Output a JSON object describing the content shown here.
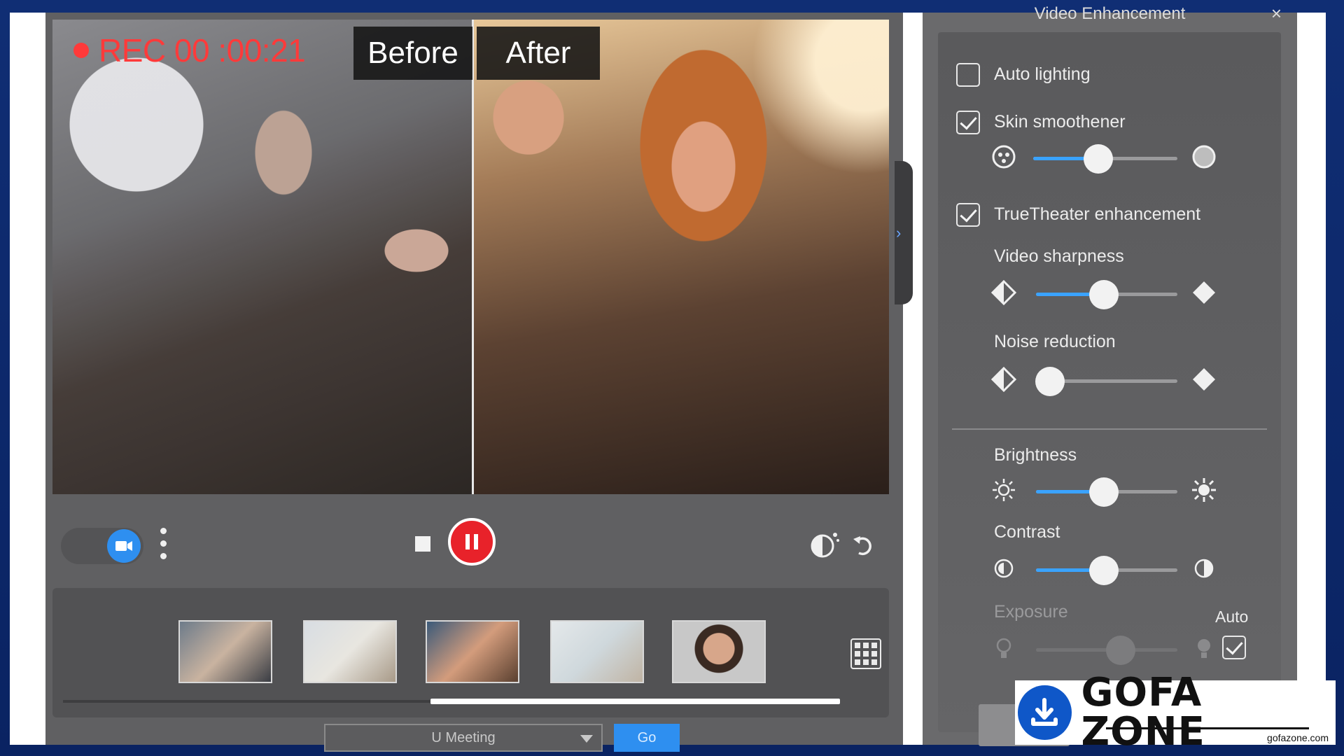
{
  "video": {
    "rec_text": "REC 00 :00:21",
    "before_label": "Before",
    "after_label": "After"
  },
  "controls": {
    "camera_toggle_on": true
  },
  "meeting": {
    "select_value": "U Meeting",
    "go_label": "Go"
  },
  "panel": {
    "title": "Video Enhancement",
    "close": "×",
    "auto_lighting": {
      "label": "Auto lighting",
      "checked": false
    },
    "skin_smoothener": {
      "label": "Skin smoothener",
      "checked": true,
      "value": 0.45
    },
    "truetheater": {
      "label": "TrueTheater enhancement",
      "checked": true
    },
    "video_sharpness": {
      "label": "Video sharpness",
      "value": 0.48
    },
    "noise_reduction": {
      "label": "Noise reduction",
      "value": 0.1
    },
    "brightness": {
      "label": "Brightness",
      "value": 0.48
    },
    "contrast": {
      "label": "Contrast",
      "value": 0.48
    },
    "exposure": {
      "label": "Exposure",
      "value": 0.6,
      "enabled": false
    },
    "auto_label": "Auto",
    "auto_checked": true
  },
  "watermark": {
    "brand": "GOFA ZONE",
    "url": "gofazone.com"
  },
  "colors": {
    "accent": "#3aa3ff",
    "record": "#e8222a",
    "frame": "#0b2a6b"
  }
}
